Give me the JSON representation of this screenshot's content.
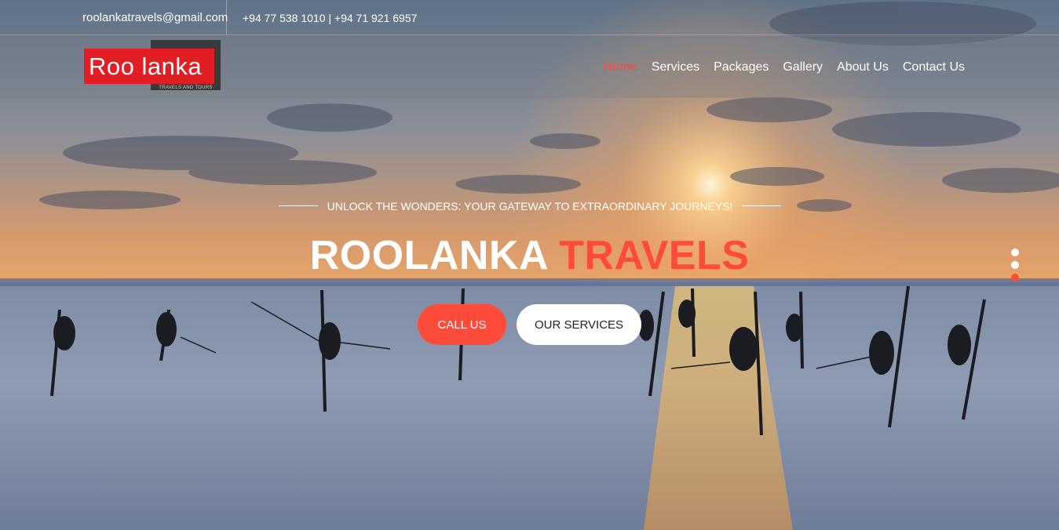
{
  "topbar": {
    "email": "roolankatravels@gmail.com",
    "phone": "+94 77 538 1010 | +94 71 921 6957"
  },
  "logo": {
    "main": "Roo lanka",
    "sub": "TRAVELS AND TOURS"
  },
  "nav": [
    {
      "label": "Home",
      "active": true
    },
    {
      "label": "Services"
    },
    {
      "label": "Packages"
    },
    {
      "label": "Gallery"
    },
    {
      "label": "About Us"
    },
    {
      "label": "Contact Us"
    }
  ],
  "hero": {
    "tagline": "UNLOCK THE WONDERS: YOUR GATEWAY TO EXTRAORDINARY JOURNEYS!",
    "title_main": "ROOLANKA",
    "title_accent": "TRAVELS",
    "btn_call": "CALL US",
    "btn_services": "OUR SERVICES"
  },
  "slider": {
    "dot_count": 3,
    "active_index": 2
  },
  "colors": {
    "accent": "#ff4b3a",
    "logo_red": "#e21d24"
  },
  "background": {
    "scene": "sunset-beach-stilt-fishermen-image"
  }
}
